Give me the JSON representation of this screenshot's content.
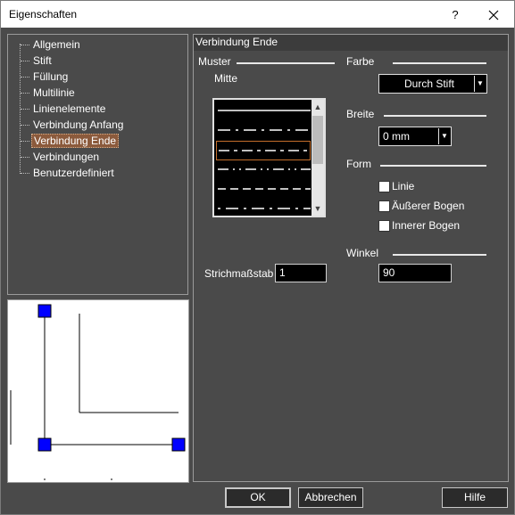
{
  "window": {
    "title": "Eigenschaften",
    "help_label": "?"
  },
  "tree": {
    "items": [
      {
        "label": "Allgemein"
      },
      {
        "label": "Stift"
      },
      {
        "label": "Füllung"
      },
      {
        "label": "Multilinie"
      },
      {
        "label": "Linienelemente"
      },
      {
        "label": "Verbindung Anfang"
      },
      {
        "label": "Verbindung Ende",
        "selected": true
      },
      {
        "label": "Verbindungen"
      },
      {
        "label": "Benutzerdefiniert"
      }
    ]
  },
  "panel": {
    "title": "Verbindung Ende",
    "muster": {
      "label": "Muster",
      "sublabel": "Mitte",
      "patterns": [
        "solid",
        "long-dash",
        "dash-dot",
        "dash-dot-dot",
        "dashed",
        "long-dash-dot"
      ],
      "selected_index": 2
    },
    "farbe": {
      "label": "Farbe",
      "value": "Durch Stift"
    },
    "breite": {
      "label": "Breite",
      "value": "0 mm"
    },
    "form": {
      "label": "Form",
      "options": [
        {
          "label": "Linie",
          "checked": false
        },
        {
          "label": "Äußerer Bogen",
          "checked": false
        },
        {
          "label": "Innerer Bogen",
          "checked": false
        }
      ]
    },
    "winkel": {
      "label": "Winkel",
      "value": "90"
    },
    "strichmassstab": {
      "label": "Strichmaßstab",
      "value": "1"
    }
  },
  "buttons": {
    "ok": "OK",
    "cancel": "Abbrechen",
    "help": "Hilfe"
  },
  "colors": {
    "background": "#4a4a4a",
    "selection": "#8b5a3c",
    "handle": "#0000ff"
  }
}
